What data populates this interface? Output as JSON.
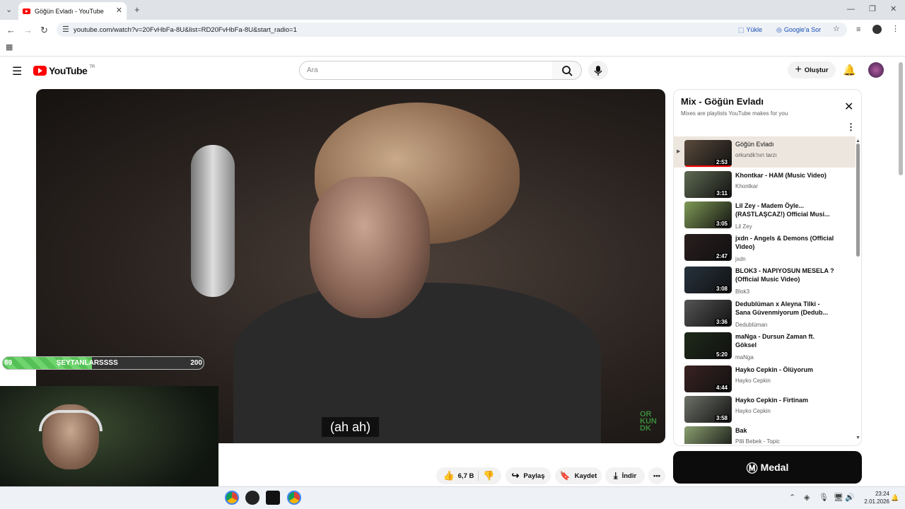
{
  "browser": {
    "tab_title": "Göğün Evladı - YouTube",
    "url": "youtube.com/watch?v=20FvHbFa-8U&list=RD20FvHbFa-8U&start_radio=1",
    "upload_label": "Yükle",
    "google_label": "Google'a Sor"
  },
  "youtube": {
    "logo": "YouTube",
    "region": "TR",
    "search_placeholder": "Ara",
    "create_label": "Oluştur"
  },
  "video": {
    "caption": "(ah ah)",
    "watermark": "OR KUN DK",
    "likes": "6,7 B",
    "share_label": "Paylaş",
    "save_label": "Kaydet",
    "download_label": "İndir"
  },
  "overlay": {
    "bar_left": "89",
    "bar_name": "ŞEYTANLARSSSS",
    "bar_right": "200",
    "bar_progress": 0.445
  },
  "playlist": {
    "title": "Mix - Göğün Evladı",
    "subtitle": "Mixes are playlists YouTube makes for you",
    "items": [
      {
        "title": "Göğün Evladı",
        "channel": "orkundk'nın tarzı",
        "duration": "2:53",
        "color": "#5a4a3c"
      },
      {
        "title": "Khontkar - HAM (Music Video)",
        "channel": "Khontkar",
        "duration": "3:11",
        "color": "#5f6a52"
      },
      {
        "title": "Lil Zey - Madem Öyle... (RASTLAŞCAZ!) Official Musi...",
        "channel": "Lil Zey",
        "duration": "3:05",
        "color": "#7f9a56"
      },
      {
        "title": "jxdn - Angels & Demons (Official Video)",
        "channel": "jxdn",
        "duration": "2:47",
        "color": "#2a1e1e"
      },
      {
        "title": "BLOK3 - NAPIYOSUN MESELA ? (Official Music Video)",
        "channel": "Blok3",
        "duration": "3:08",
        "color": "#26323e"
      },
      {
        "title": "Dedublüman x Aleyna Tilki - Sana Güvenmiyorum (Dedub...",
        "channel": "Dedublüman",
        "duration": "3:36",
        "color": "#555"
      },
      {
        "title": "maNga - Dursun Zaman ft. Göksel",
        "channel": "maNga",
        "duration": "5:20",
        "color": "#1e2a18"
      },
      {
        "title": "Hayko Cepkin - Ölüyorum",
        "channel": "Hayko Cepkin",
        "duration": "4:44",
        "color": "#3a2222"
      },
      {
        "title": "Hayko Cepkin - Firtinam",
        "channel": "Hayko Cepkin",
        "duration": "3:58",
        "color": "#6d7268"
      },
      {
        "title": "Bak",
        "channel": "Pilli Bebek - Topic",
        "duration": "",
        "color": "#8aa070"
      }
    ]
  },
  "ad": {
    "label": "Medal"
  },
  "taskbar": {
    "time": "23:24",
    "date": "2.01.2026"
  }
}
